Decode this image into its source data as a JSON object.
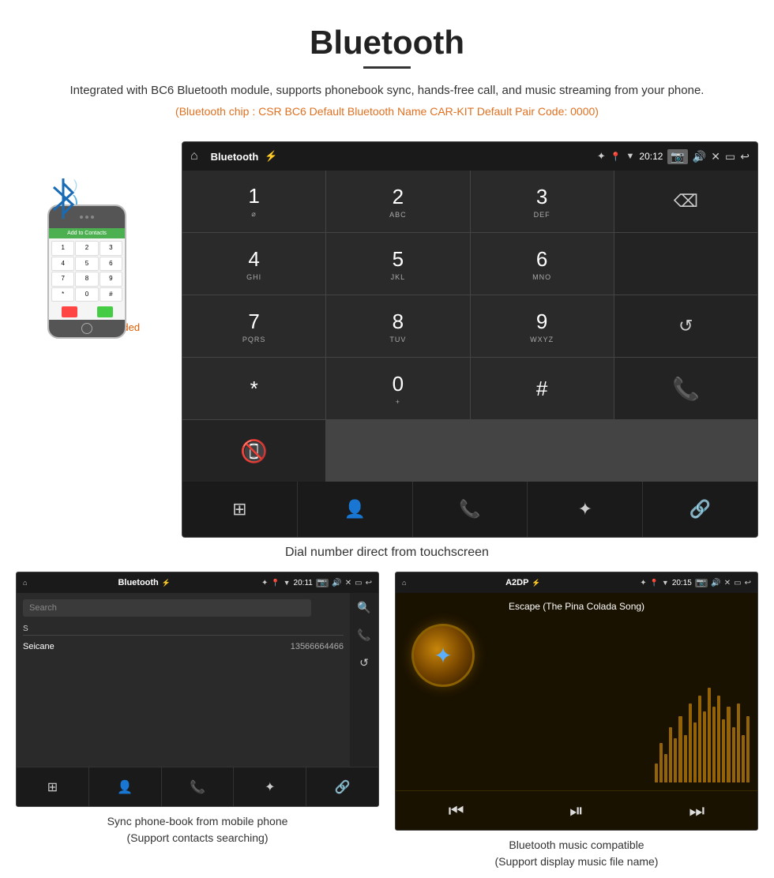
{
  "header": {
    "title": "Bluetooth",
    "description": "Integrated with BC6 Bluetooth module, supports phonebook sync, hands-free call, and music streaming from your phone.",
    "specs": "(Bluetooth chip : CSR BC6    Default Bluetooth Name CAR-KIT    Default Pair Code: 0000)"
  },
  "main_screen": {
    "status_bar": {
      "left_icon": "home",
      "center_label": "Bluetooth",
      "usb_icon": "usb",
      "bt_icon": "bluetooth",
      "location_icon": "location",
      "signal_icon": "signal",
      "time": "20:12",
      "camera_icon": "camera",
      "volume_icon": "volume",
      "close_icon": "close",
      "window_icon": "window",
      "back_icon": "back"
    },
    "dialpad": {
      "rows": [
        [
          {
            "num": "1",
            "sub": ""
          },
          {
            "num": "2",
            "sub": "ABC"
          },
          {
            "num": "3",
            "sub": "DEF"
          },
          {
            "action": "backspace"
          }
        ],
        [
          {
            "num": "4",
            "sub": "GHI"
          },
          {
            "num": "5",
            "sub": "JKL"
          },
          {
            "num": "6",
            "sub": "MNO"
          },
          {
            "empty": true
          }
        ],
        [
          {
            "num": "7",
            "sub": "PQRS"
          },
          {
            "num": "8",
            "sub": "TUV"
          },
          {
            "num": "9",
            "sub": "WXYZ"
          },
          {
            "action": "refresh"
          }
        ],
        [
          {
            "num": "*",
            "sub": ""
          },
          {
            "num": "0",
            "sub": "+"
          },
          {
            "num": "#",
            "sub": ""
          },
          {
            "action": "call"
          },
          {
            "action": "end"
          }
        ],
        [
          {
            "action": "grid"
          },
          {
            "action": "person"
          },
          {
            "action": "phone-outline"
          },
          {
            "action": "bluetooth"
          },
          {
            "action": "link"
          }
        ]
      ],
      "bottom_nav": [
        "grid",
        "person",
        "phone",
        "bluetooth",
        "link"
      ]
    }
  },
  "main_caption": "Dial number direct from touchscreen",
  "phone_area": {
    "not_included": "Phone Not Included",
    "screen_header": "Add to Contacts"
  },
  "bottom_left": {
    "status_bar": {
      "center_label": "Bluetooth",
      "time": "20:11"
    },
    "search_placeholder": "Search",
    "contact_section": "S",
    "contact_name": "Seicane",
    "contact_number": "13566664466",
    "caption_line1": "Sync phone-book from mobile phone",
    "caption_line2": "(Support contacts searching)"
  },
  "bottom_right": {
    "status_bar": {
      "center_label": "A2DP",
      "time": "20:15"
    },
    "song_title": "Escape (The Pina Colada Song)",
    "viz_bars": [
      12,
      25,
      18,
      35,
      28,
      42,
      30,
      50,
      38,
      55,
      45,
      60,
      48,
      55,
      40,
      48,
      35,
      50,
      30,
      42
    ],
    "caption_line1": "Bluetooth music compatible",
    "caption_line2": "(Support display music file name)"
  }
}
